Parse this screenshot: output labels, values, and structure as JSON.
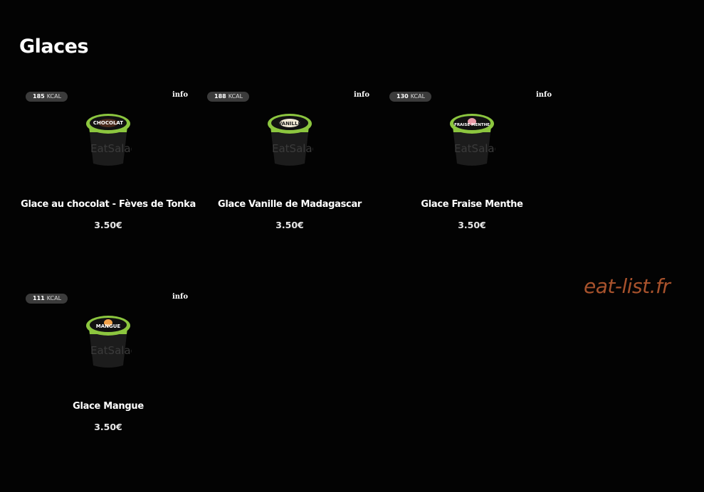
{
  "page": {
    "title": "Glaces"
  },
  "products": [
    {
      "kcal_value": "185",
      "kcal_unit": "KCAL",
      "info_label": "info",
      "name": "Glace au chocolat - Fèves de Tonka",
      "price": "3.50€",
      "lid_label": "CHOCOLAT",
      "lid_color": "#4a2a1c",
      "brand": "EatSalad"
    },
    {
      "kcal_value": "188",
      "kcal_unit": "KCAL",
      "info_label": "info",
      "name": "Glace Vanille de Madagascar",
      "price": "3.50€",
      "lid_label": "VANILLE",
      "lid_color": "#f2ead6",
      "brand": "EatSalad"
    },
    {
      "kcal_value": "130",
      "kcal_unit": "KCAL",
      "info_label": "info",
      "name": "Glace Fraise Menthe",
      "price": "3.50€",
      "lid_label": "FRAISE MENTHE",
      "lid_color": "#e89aa8",
      "brand": "EatSalad"
    },
    {
      "kcal_value": "111",
      "kcal_unit": "KCAL",
      "info_label": "info",
      "name": "Glace Mangue",
      "price": "3.50€",
      "lid_label": "MANGUE",
      "lid_color": "#f2a24a",
      "brand": "EatSalad"
    }
  ],
  "watermark": "eat-list.fr",
  "colors": {
    "background": "#030303",
    "badge_bg": "#3b3b3b",
    "cup_green": "#8cc63f",
    "cup_body": "#1c1c1c",
    "watermark": "#a8522c"
  }
}
